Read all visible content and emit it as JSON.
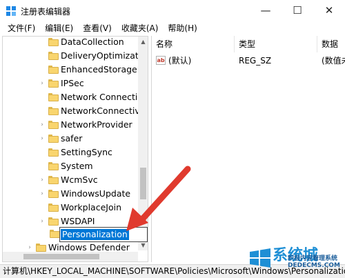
{
  "window": {
    "title": "注册表编辑器",
    "minimize_glyph": "—",
    "maximize_glyph": "☐",
    "close_glyph": "✕"
  },
  "menu": [
    "文件(F)",
    "编辑(E)",
    "查看(V)",
    "收藏夹(A)",
    "帮助(H)"
  ],
  "tree": {
    "items": [
      {
        "label": "DataCollection",
        "expandable": false
      },
      {
        "label": "DeliveryOptimizatio",
        "expandable": false
      },
      {
        "label": "EnhancedStorageD",
        "expandable": false
      },
      {
        "label": "IPSec",
        "expandable": true
      },
      {
        "label": "Network Connectio",
        "expandable": false
      },
      {
        "label": "NetworkConnectivi",
        "expandable": false
      },
      {
        "label": "NetworkProvider",
        "expandable": true
      },
      {
        "label": "safer",
        "expandable": true
      },
      {
        "label": "SettingSync",
        "expandable": false
      },
      {
        "label": "System",
        "expandable": false
      },
      {
        "label": "WcmSvc",
        "expandable": true
      },
      {
        "label": "WindowsUpdate",
        "expandable": true
      },
      {
        "label": "WorkplaceJoin",
        "expandable": false
      },
      {
        "label": "WSDAPI",
        "expandable": true
      }
    ],
    "editing_label": "Personalization",
    "partial_item": "Windows Defender"
  },
  "values_pane": {
    "columns": [
      "名称",
      "类型",
      "数据"
    ],
    "rows": [
      {
        "name": "(默认)",
        "type": "REG_SZ",
        "data": "(数值未"
      }
    ]
  },
  "status_bar": {
    "path": "计算机\\HKEY_LOCAL_MACHINE\\SOFTWARE\\Policies\\Microsoft\\Windows\\Personalization"
  },
  "annotation": {
    "color": "#e03a2e"
  },
  "watermark": {
    "line1": "系统城",
    "line2": "积极内容管理系统",
    "line3": "DEDECMS.COM"
  },
  "colors": {
    "selection": "#0078d7",
    "folder": "#f9d56e"
  }
}
